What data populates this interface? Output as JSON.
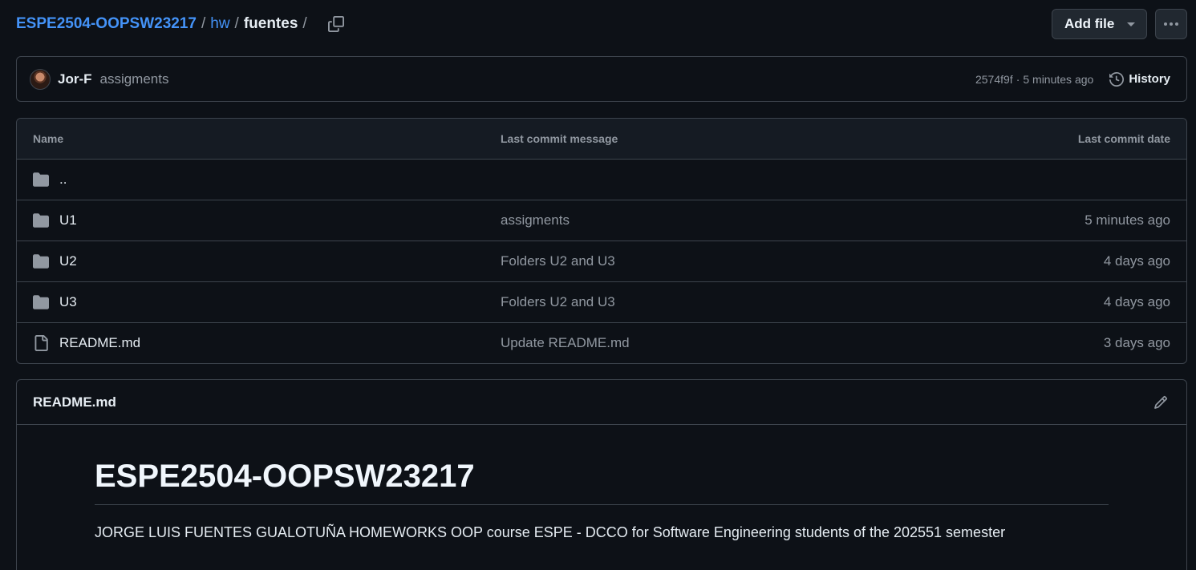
{
  "breadcrumb": {
    "repo": "ESPE2504-OOPSW23217",
    "folder": "hw",
    "current": "fuentes",
    "sep": "/"
  },
  "toolbar": {
    "add_file_label": "Add file"
  },
  "commit": {
    "author": "Jor-F",
    "message": "assigments",
    "sha": "2574f9f",
    "separator": "·",
    "time": "5 minutes ago",
    "history_label": "History"
  },
  "table": {
    "headers": {
      "name": "Name",
      "message": "Last commit message",
      "date": "Last commit date"
    },
    "rows": [
      {
        "icon": "folder-icon",
        "name": "..",
        "message": "",
        "date": ""
      },
      {
        "icon": "folder-icon",
        "name": "U1",
        "message": "assigments",
        "date": "5 minutes ago"
      },
      {
        "icon": "folder-icon",
        "name": "U2",
        "message": "Folders U2 and U3",
        "date": "4 days ago"
      },
      {
        "icon": "folder-icon",
        "name": "U3",
        "message": "Folders U2 and U3",
        "date": "4 days ago"
      },
      {
        "icon": "file-icon",
        "name": "README.md",
        "message": "Update README.md",
        "date": "3 days ago"
      }
    ]
  },
  "readme": {
    "title": "README.md",
    "heading": "ESPE2504-OOPSW23217",
    "paragraph": "JORGE LUIS FUENTES GUALOTUÑA HOMEWORKS OOP course ESPE - DCCO for Software Engineering students of the 202551 semester"
  },
  "colors": {
    "background": "#0d1117",
    "link": "#4493f8",
    "border": "#3d444d",
    "muted": "#9198a1",
    "text": "#e6edf3"
  }
}
